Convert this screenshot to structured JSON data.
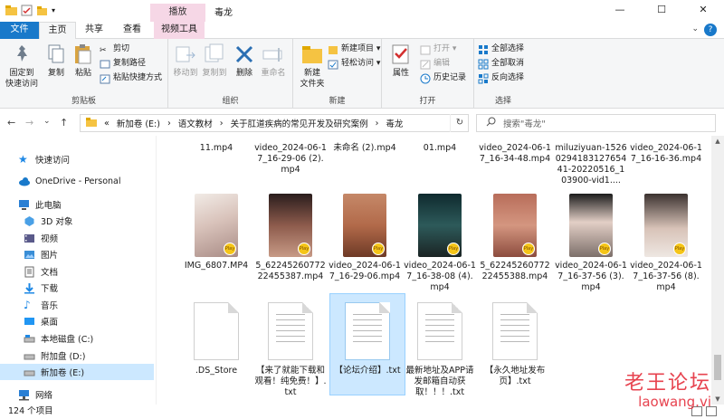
{
  "window": {
    "title": "毒龙",
    "context_tab": "播放",
    "min": "—",
    "max": "☐",
    "close": "✕"
  },
  "tabs": {
    "file": "文件",
    "home": "主页",
    "share": "共享",
    "view": "查看",
    "video_tools": "视频工具"
  },
  "ribbon": {
    "clipboard": {
      "label": "剪贴板",
      "pin": "固定到\n快速访问",
      "copy": "复制",
      "paste": "粘贴",
      "cut": "剪切",
      "copy_path": "复制路径",
      "paste_shortcut": "粘贴快捷方式"
    },
    "organize": {
      "label": "组织",
      "move_to": "移动到",
      "copy_to": "复制到",
      "delete": "删除",
      "rename": "重命名"
    },
    "new": {
      "label": "新建",
      "new_folder": "新建\n文件夹",
      "new_item": "新建项目 ▾",
      "easy_access": "轻松访问 ▾"
    },
    "open": {
      "label": "打开",
      "properties": "属性",
      "open": "打开 ▾",
      "edit": "编辑",
      "history": "历史记录"
    },
    "select": {
      "label": "选择",
      "select_all": "全部选择",
      "select_none": "全部取消",
      "invert": "反向选择"
    }
  },
  "address": {
    "back": "←",
    "forward": "→",
    "dropdown": "⌄",
    "up": "↑",
    "path": [
      "«",
      "新加卷 (E:)",
      "›",
      "语文教材",
      "›",
      "关于肛道疾病的常见开发及研究案例",
      "›",
      "毒龙"
    ],
    "refresh": "↻",
    "search_placeholder": "搜索\"毒龙\""
  },
  "nav": [
    {
      "label": "快速访问",
      "icon": "star-icon",
      "color": "#1e88e5"
    },
    {
      "label": "OneDrive - Personal",
      "icon": "cloud-icon",
      "color": "#1979ca"
    },
    {
      "label": "此电脑",
      "icon": "computer-icon",
      "color": "#2a7fd4"
    },
    {
      "label": "3D 对象",
      "icon": "cube-icon",
      "color": "#4aa0e6"
    },
    {
      "label": "视频",
      "icon": "video-icon",
      "color": "#5a5a8a"
    },
    {
      "label": "图片",
      "icon": "picture-icon",
      "color": "#3a8ed6"
    },
    {
      "label": "文档",
      "icon": "document-icon",
      "color": "#6a6a6a"
    },
    {
      "label": "下载",
      "icon": "download-icon",
      "color": "#1e88e5"
    },
    {
      "label": "音乐",
      "icon": "music-icon",
      "color": "#1e88e5"
    },
    {
      "label": "桌面",
      "icon": "desktop-icon",
      "color": "#2196f3"
    },
    {
      "label": "本地磁盘 (C:)",
      "icon": "drive-icon",
      "color": "#7a7a7a"
    },
    {
      "label": "附加盘 (D:)",
      "icon": "drive-icon",
      "color": "#7a7a7a"
    },
    {
      "label": "新加卷 (E:)",
      "icon": "drive-icon",
      "color": "#7a7a7a"
    },
    {
      "label": "网络",
      "icon": "network-icon",
      "color": "#2a7fd4"
    }
  ],
  "row1": [
    "11.mp4",
    "video_2024-06-17_16-29-06 (2).mp4",
    "未命名 (2).mp4",
    "01.mp4",
    "video_2024-06-17_16-34-48.mp4",
    "miluziyuan-1526029418312765441-20220516_103900-vid1....",
    "video_2024-06-17_16-16-36.mp4"
  ],
  "row2": [
    "IMG_6807.MP4",
    "5_6224526077222455387.mp4",
    "video_2024-06-17_16-29-06.mp4",
    "video_2024-06-17_16-38-08 (4).mp4",
    "5_6224526077222455388.mp4",
    "video_2024-06-17_16-37-56 (3).mp4",
    "video_2024-06-17_16-37-56 (8).mp4"
  ],
  "row3": [
    ".DS_Store",
    "【来了就能下载和观看！纯免费！】.txt",
    "【论坛介绍】.txt",
    "最新地址及APP请发邮箱自动获取！！！.txt",
    "【永久地址发布页】.txt"
  ],
  "badge_text": "Player",
  "status": {
    "count": "124 个项目"
  },
  "watermark": {
    "line1": "老王论坛",
    "line2": "laowang.vi"
  },
  "colors": {
    "accent": "#1979ca",
    "context_tab": "#f6d7e6",
    "selection": "#cce8ff"
  }
}
